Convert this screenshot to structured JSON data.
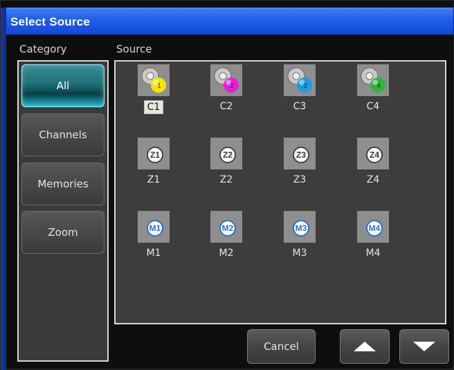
{
  "window": {
    "title": "Select Source"
  },
  "labels": {
    "category": "Category",
    "source": "Source"
  },
  "categories": [
    {
      "label": "All",
      "active": true
    },
    {
      "label": "Channels",
      "active": false
    },
    {
      "label": "Memories",
      "active": false
    },
    {
      "label": "Zoom",
      "active": false
    }
  ],
  "sources": [
    {
      "label": "C1",
      "type": "channel",
      "badge": "1",
      "color": "#f4e400",
      "selected": true
    },
    {
      "label": "C2",
      "type": "channel",
      "badge": "2",
      "color": "#e51fd6",
      "selected": false
    },
    {
      "label": "C3",
      "type": "channel",
      "badge": "3",
      "color": "#1d9be6",
      "selected": false
    },
    {
      "label": "C4",
      "type": "channel",
      "badge": "4",
      "color": "#2fb53a",
      "selected": false
    },
    {
      "label": "Z1",
      "type": "zoom",
      "badge": "Z1",
      "selected": false
    },
    {
      "label": "Z2",
      "type": "zoom",
      "badge": "Z2",
      "selected": false
    },
    {
      "label": "Z3",
      "type": "zoom",
      "badge": "Z3",
      "selected": false
    },
    {
      "label": "Z4",
      "type": "zoom",
      "badge": "Z4",
      "selected": false
    },
    {
      "label": "M1",
      "type": "memory",
      "badge": "M1",
      "selected": false
    },
    {
      "label": "M2",
      "type": "memory",
      "badge": "M2",
      "selected": false
    },
    {
      "label": "M3",
      "type": "memory",
      "badge": "M3",
      "selected": false
    },
    {
      "label": "M4",
      "type": "memory",
      "badge": "M4",
      "selected": false
    }
  ],
  "buttons": {
    "cancel": "Cancel",
    "up_icon": "up-arrow-icon",
    "down_icon": "down-arrow-icon"
  }
}
